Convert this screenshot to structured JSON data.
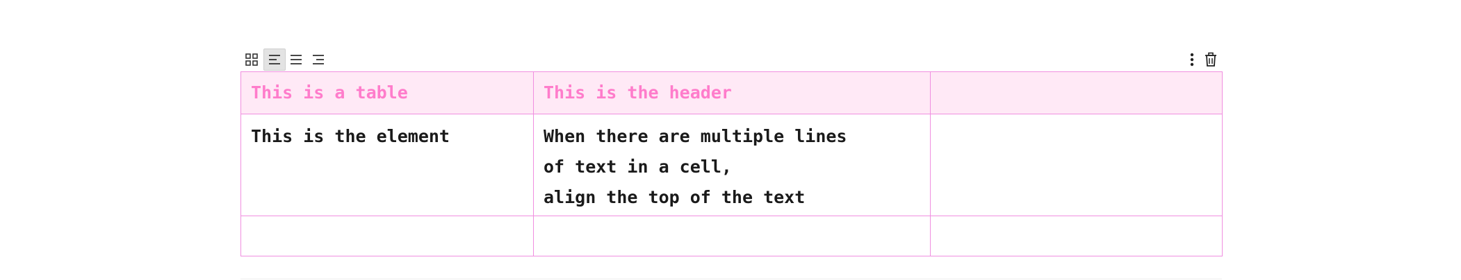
{
  "toolbar": {
    "left_buttons": [
      {
        "name": "table-grid-icon",
        "active": false
      },
      {
        "name": "align-left-icon",
        "active": true
      },
      {
        "name": "align-center-icon",
        "active": false
      },
      {
        "name": "align-right-icon",
        "active": false
      }
    ],
    "right_buttons": [
      {
        "name": "more-vertical-icon"
      },
      {
        "name": "trash-icon"
      }
    ]
  },
  "table": {
    "header": [
      "This is a table",
      "This is the header",
      ""
    ],
    "rows": [
      {
        "cells": [
          [
            "This is the element"
          ],
          [
            "When there are multiple lines",
            "of text in a cell,",
            "align the top of the text"
          ],
          []
        ]
      },
      {
        "cells": [
          [],
          [],
          []
        ]
      }
    ]
  },
  "colors": {
    "border": "#f08ee0",
    "header_bg": "#ffe9f6",
    "header_text": "#ff7ccb",
    "body_text": "#1a1a1a",
    "active_button_bg": "#e3e3e3"
  }
}
